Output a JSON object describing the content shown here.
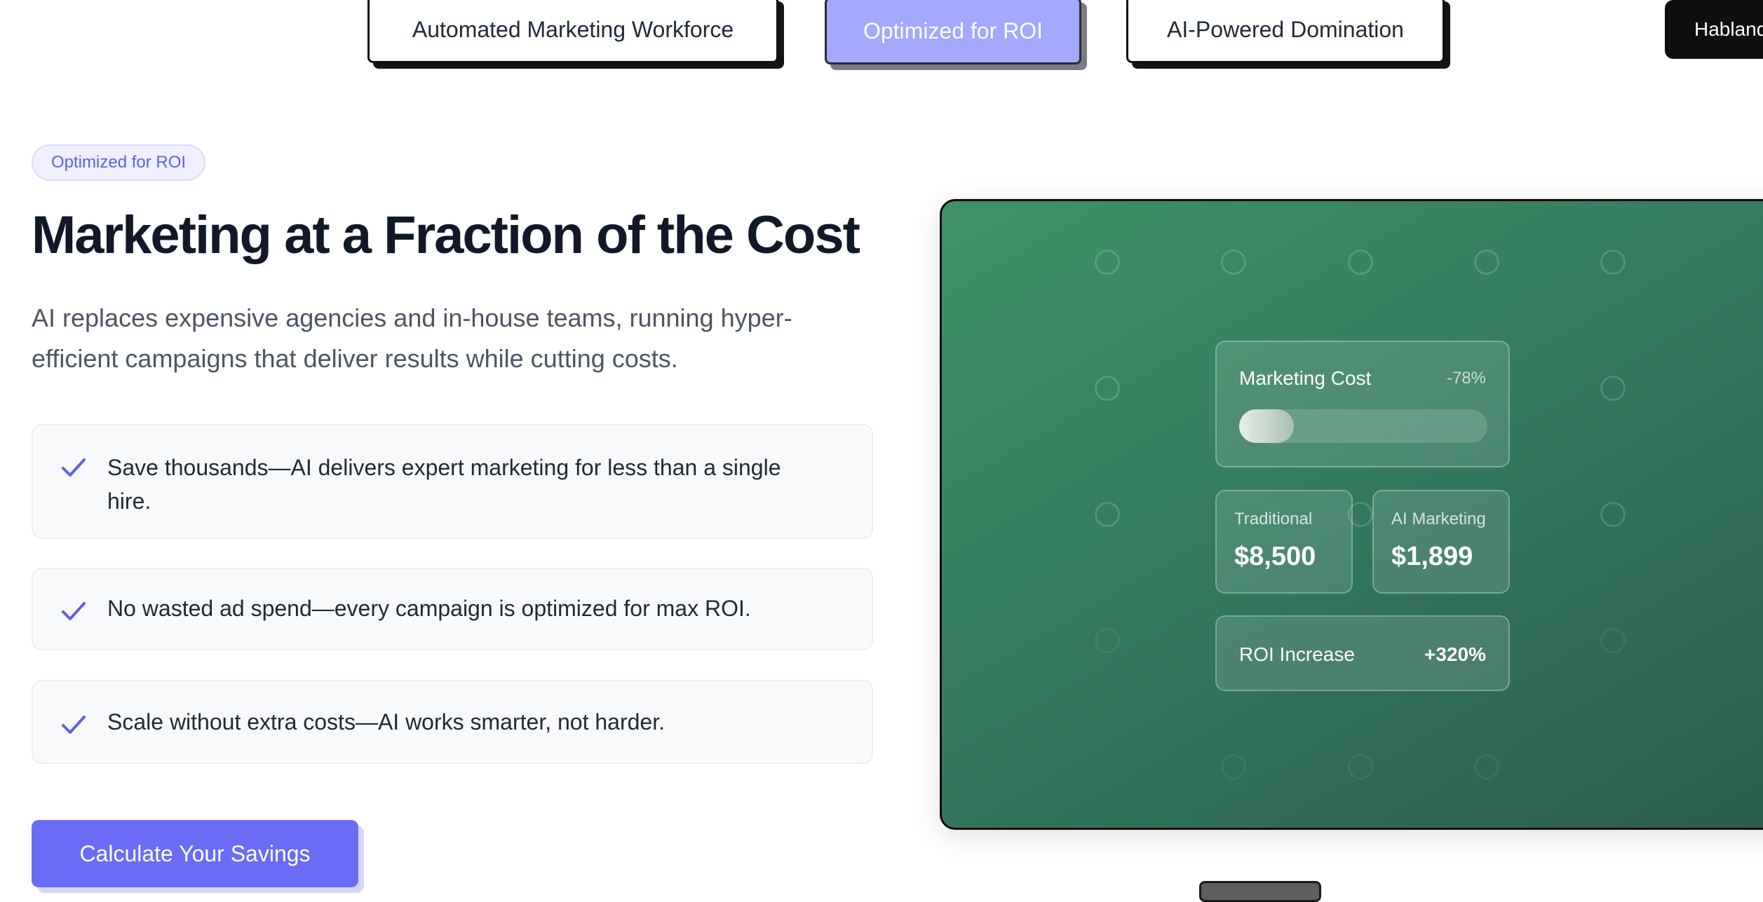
{
  "tabs": [
    {
      "label": "Automated Marketing Workforce",
      "active": false
    },
    {
      "label": "Optimized for ROI",
      "active": true
    },
    {
      "label": "AI-Powered Domination",
      "active": false
    }
  ],
  "language_button": {
    "label": "Hablando"
  },
  "section": {
    "badge": "Optimized for ROI",
    "title": "Marketing at a Fraction of the Cost",
    "lead": "AI replaces expensive agencies and in-house teams, running hyper-efficient campaigns that deliver results while cutting costs.",
    "features": [
      "Save thousands—AI delivers expert marketing for less than a single hire.",
      "No wasted ad spend—every campaign is optimized for max ROI.",
      "Scale without extra costs—AI works smarter, not harder."
    ],
    "cta_label": "Calculate Your Savings"
  },
  "panel": {
    "cost_card": {
      "label": "Marketing Cost",
      "change": "-78%",
      "bar_fill_fraction": 0.22
    },
    "traditional": {
      "label": "Traditional",
      "value": "$8,500"
    },
    "ai": {
      "label": "AI Marketing",
      "value": "$1,899"
    },
    "roi": {
      "label": "ROI Increase",
      "value": "+320%"
    }
  },
  "colors": {
    "accent": "#6a6cf6",
    "tab_active": "#a4a8ff",
    "panel_green": "#347a5f",
    "check": "#5b61e8"
  }
}
